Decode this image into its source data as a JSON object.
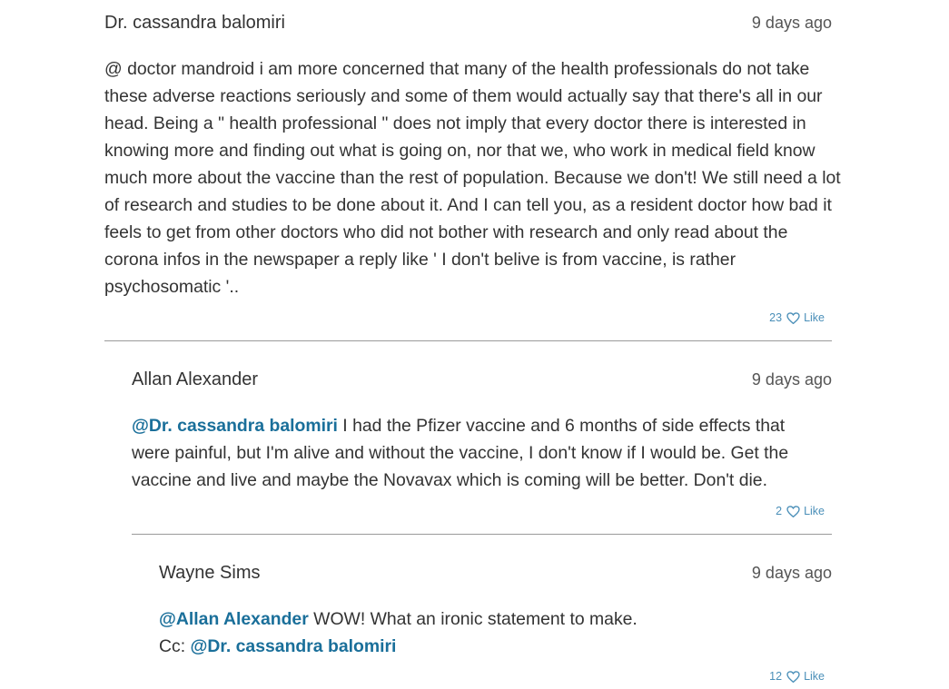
{
  "comments": [
    {
      "author": "Dr. cassandra balomiri",
      "time": "9 days ago",
      "text": "@ doctor mandroid i am more concerned that many of the health professionals do not take these adverse reactions seriously and some of them would actually say that there's all in our head. Being a \" health professional \" does not imply that every doctor there is interested in knowing more and finding out what is going on, nor that we, who work in medical field know much more about the vaccine than the rest of population. Because we don't! We still need a lot of research and studies to be done about it. And I can tell you, as a resident doctor how bad it feels to get from other doctors who did not bother with research and only read about the corona infos in the newspaper a reply like ' I don't belive is from vaccine, is rather psychosomatic '..",
      "likes": "23",
      "like_label": "Like"
    },
    {
      "author": "Allan Alexander",
      "time": "9 days ago",
      "mention": "@Dr. cassandra balomiri",
      "text": " I had the Pfizer vaccine and 6 months of side effects that were painful, but I'm alive and without the vaccine, I don't know if I would be. Get the vaccine and live and maybe the Novavax which is coming will be better. Don't die.",
      "likes": "2",
      "like_label": "Like"
    },
    {
      "author": "Wayne Sims",
      "time": "9 days ago",
      "mention": "@Allan Alexander",
      "text": " WOW! What an ironic statement to make.",
      "cc_label": "Cc: ",
      "cc_mention": "@Dr. cassandra balomiri",
      "likes": "12",
      "like_label": "Like"
    }
  ],
  "colors": {
    "mention": "#1a6f9a",
    "like": "#4a8fb8",
    "divider": "#9a9a9a"
  },
  "icons": {
    "like": "heart-outline-icon"
  }
}
